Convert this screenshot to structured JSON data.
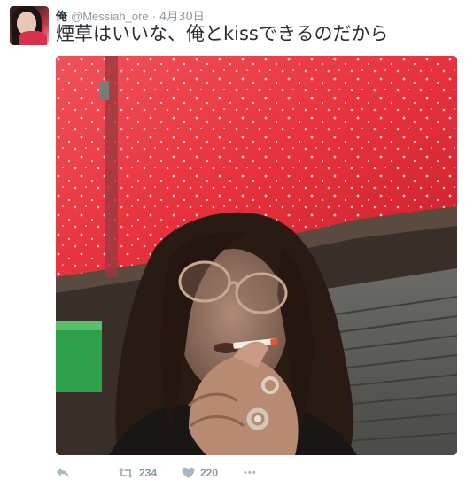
{
  "tweet": {
    "author": {
      "display_name": "俺",
      "screen_name": "@Messiah_ore",
      "avatar_icon": "profile-photo"
    },
    "separator": "·",
    "timestamp": "4月30日",
    "text": "煙草はいいな、俺とkissできるのだから",
    "media": {
      "kind": "photo",
      "dominant_colors": [
        "#e8303a",
        "#2a1e1a",
        "#5a5a58"
      ]
    },
    "actions": {
      "reply": {
        "icon": "reply-icon"
      },
      "retweet": {
        "icon": "retweet-icon",
        "count": "234"
      },
      "like": {
        "icon": "heart-icon",
        "count": "220"
      },
      "more": {
        "icon": "more-dots-icon",
        "label": "•••"
      }
    }
  },
  "colors": {
    "text": "#292f33",
    "secondary": "#8899a6",
    "background": "#ffffff"
  }
}
